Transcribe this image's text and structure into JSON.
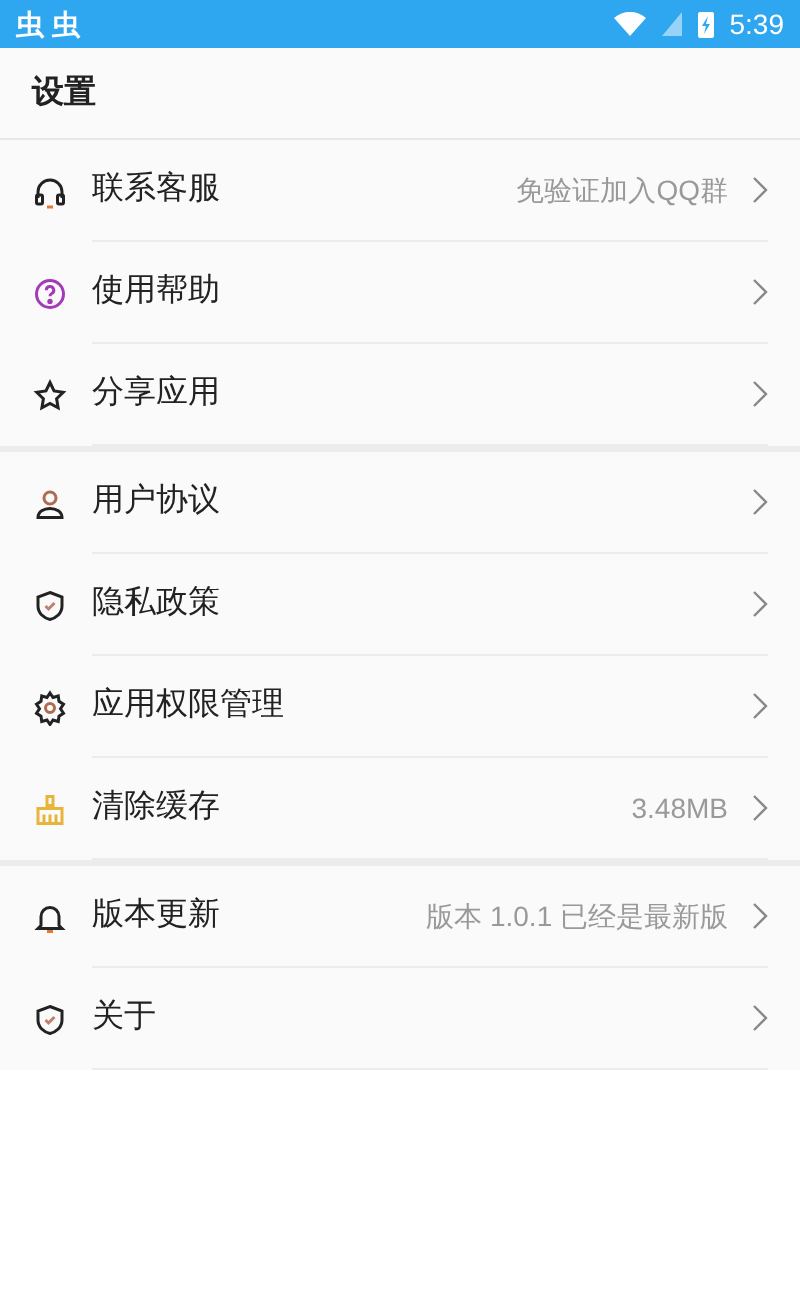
{
  "status_bar": {
    "notifications": [
      "虫",
      "虫"
    ],
    "time": "5:39"
  },
  "header": {
    "title": "设置"
  },
  "groups": [
    {
      "items": [
        {
          "label": "联系客服",
          "detail": "免验证加入QQ群"
        },
        {
          "label": "使用帮助"
        },
        {
          "label": "分享应用"
        }
      ]
    },
    {
      "items": [
        {
          "label": "用户协议"
        },
        {
          "label": "隐私政策"
        },
        {
          "label": "应用权限管理"
        },
        {
          "label": "清除缓存",
          "detail": "3.48MB"
        }
      ]
    },
    {
      "items": [
        {
          "label": "版本更新",
          "detail": "版本 1.0.1 已经是最新版"
        },
        {
          "label": "关于"
        }
      ]
    }
  ]
}
